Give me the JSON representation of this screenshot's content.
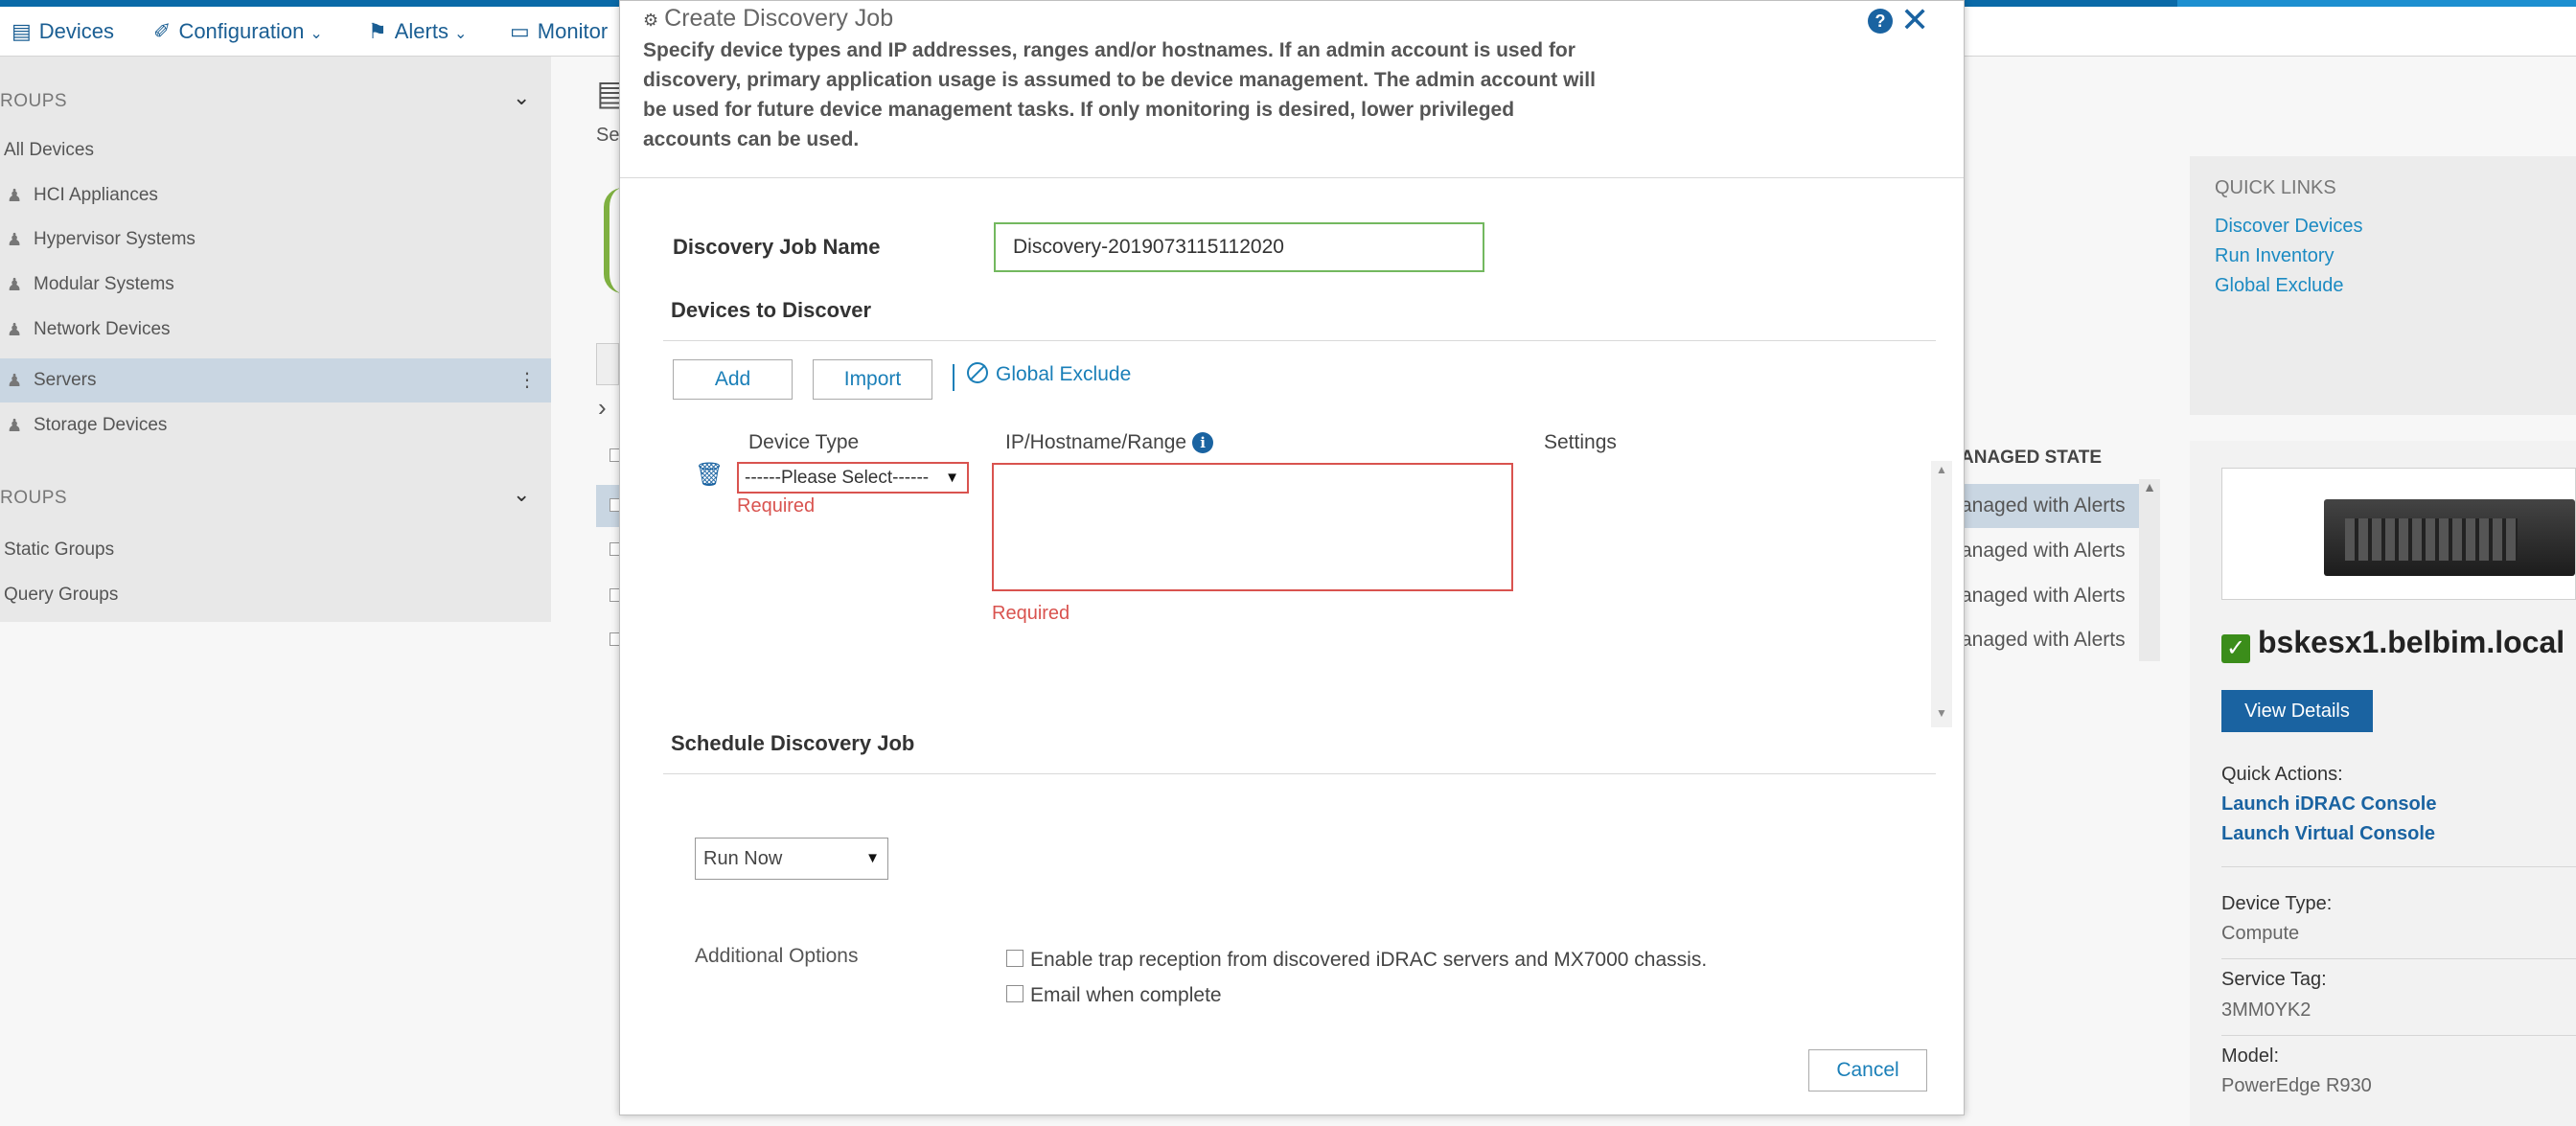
{
  "background": {
    "nav": {
      "devices": "Devices",
      "configuration": "Configuration",
      "alerts": "Alerts",
      "monitor": "Monitor"
    },
    "left_panel": {
      "groups_heading_1": "ROUPS",
      "groups_heading_2": "ROUPS",
      "items_1": [
        "All Devices",
        "HCI Appliances",
        "Hypervisor Systems",
        "Modular Systems",
        "Network Devices",
        "Servers",
        "Storage Devices"
      ],
      "items_2": [
        "Static Groups",
        "Query Groups"
      ],
      "selected_item": "Servers"
    },
    "mid_fragments": {
      "se": "Se"
    },
    "managed_state": {
      "header": "ANAGED STATE",
      "rows": [
        "anaged with Alerts",
        "anaged with Alerts",
        "anaged with Alerts",
        "anaged with Alerts"
      ]
    },
    "quick_links": {
      "title": "QUICK LINKS",
      "links": [
        "Discover Devices",
        "Run Inventory",
        "Global Exclude"
      ]
    },
    "device_detail": {
      "hostname": "bskesx1.belbim.local",
      "view_details": "View Details",
      "quick_actions_label": "Quick Actions:",
      "actions": [
        "Launch iDRAC Console",
        "Launch Virtual Console"
      ],
      "device_type_label": "Device Type:",
      "device_type_value": "Compute",
      "service_tag_label": "Service Tag:",
      "service_tag_value": "3MM0YK2",
      "model_label": "Model:",
      "model_value": "PowerEdge R930"
    }
  },
  "modal": {
    "title": "Create Discovery Job",
    "description": "Specify device types and IP addresses, ranges and/or hostnames. If an admin account is used for discovery, primary application usage is assumed to be device management. The admin account will be used for future device management tasks. If only monitoring is desired, lower privileged accounts can be used.",
    "job_name_label": "Discovery Job Name",
    "job_name_value": "Discovery-2019073115112020",
    "devices_section": "Devices to Discover",
    "add_button": "Add",
    "import_button": "Import",
    "global_exclude_link": "Global Exclude",
    "col_device_type": "Device Type",
    "col_ip": "IP/Hostname/Range",
    "col_settings": "Settings",
    "device_type_selected": "------Please Select------",
    "required_text": "Required",
    "schedule_section": "Schedule Discovery Job",
    "schedule_selected": "Run Now",
    "additional_options_label": "Additional Options",
    "option_trap": "Enable trap reception from discovered iDRAC servers and MX7000 chassis.",
    "option_email": "Email when complete",
    "cancel_button": "Cancel"
  },
  "colors": {
    "accent_blue": "#1a63a1",
    "link_blue": "#1a7fb8",
    "error_red": "#d9534f",
    "valid_green": "#73b85f",
    "selected_row": "#c9d6e2"
  }
}
